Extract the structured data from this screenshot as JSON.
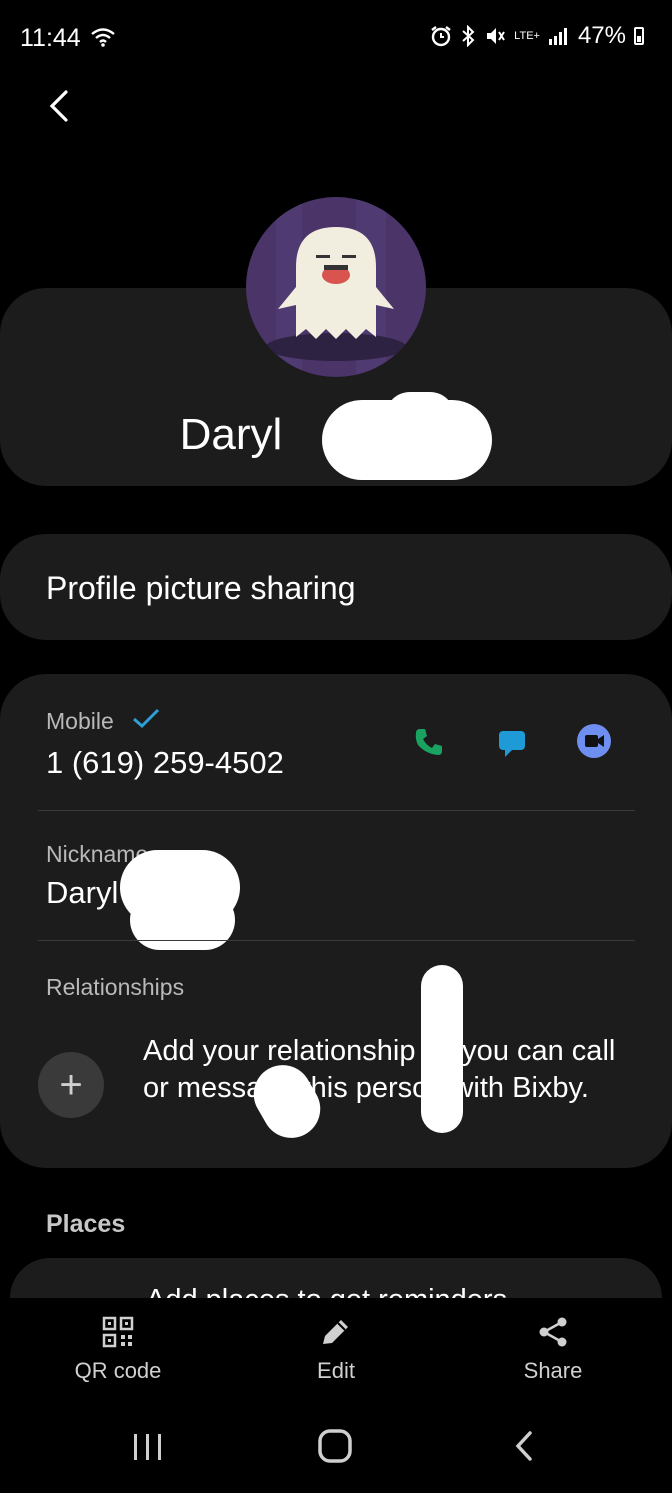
{
  "status_bar": {
    "time": "11:44",
    "lte_label": "LTE+",
    "battery": "47%"
  },
  "contact": {
    "name": "Daryl"
  },
  "profile_picture_sharing_label": "Profile picture sharing",
  "phone": {
    "type_label": "Mobile",
    "number": "1 (619) 259-4502"
  },
  "nickname": {
    "label": "Nickname",
    "value": "Daryl"
  },
  "relationships": {
    "label": "Relationships",
    "prompt": "Add your relationship so you can call or message this person with Bixby."
  },
  "places": {
    "label": "Places",
    "partial_text": "Add places to get reminders..."
  },
  "toolbar": {
    "qr_label": "QR code",
    "edit_label": "Edit",
    "share_label": "Share"
  },
  "colors": {
    "call_green": "#1aa260",
    "message_blue": "#1e9bd7",
    "video_blue": "#6f8ff0",
    "card_bg": "#1c1c1c",
    "avatar_purple": "#4a3468"
  },
  "icons": [
    "wifi-icon",
    "alarm-icon",
    "bluetooth-icon",
    "mute-icon",
    "signal-icon",
    "battery-icon",
    "back-icon",
    "call-icon",
    "message-icon",
    "video-call-icon",
    "verified-check-icon",
    "add-icon",
    "qr-code-icon",
    "edit-pencil-icon",
    "share-icon",
    "recent-apps-icon",
    "home-icon",
    "nav-back-icon"
  ]
}
